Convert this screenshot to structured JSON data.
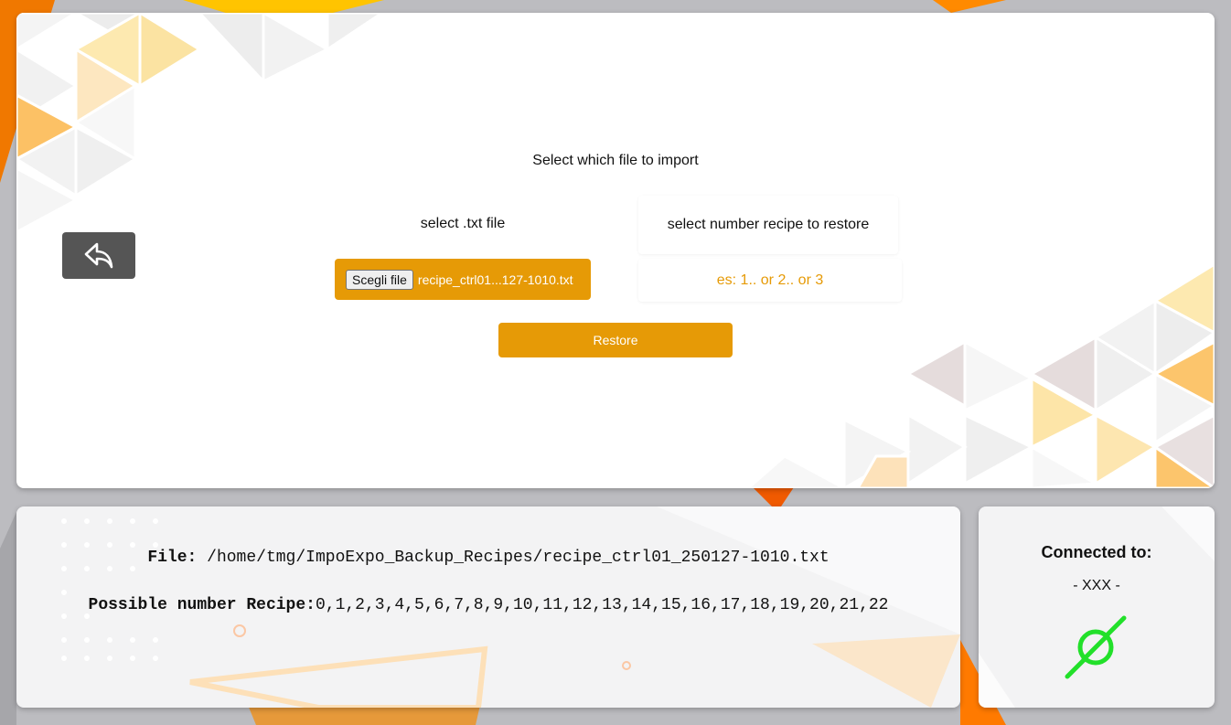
{
  "main": {
    "title": "Select which file to import",
    "file_label": "select .txt file",
    "recipe_label": "select number recipe to restore",
    "choose_button_label": "Scegli file",
    "selected_file": "recipe_ctrl01...127-1010.txt",
    "recipe_placeholder": "es: 1.. or 2.. or 3",
    "restore_label": "Restore",
    "back_icon": "undo-arrow-icon"
  },
  "info": {
    "file_label": "File:",
    "file_path": " /home/tmg/ImpoExpo_Backup_Recipes/recipe_ctrl01_250127-1010.txt",
    "recipes_label": "Possible number Recipe:",
    "recipes_list": "0,1,2,3,4,5,6,7,8,9,10,11,12,13,14,15,16,17,18,19,20,21,22"
  },
  "connection": {
    "title": "Connected to:",
    "name": "- XXX -",
    "status_icon": "plug-connected-icon",
    "status_color": "#22e02a"
  },
  "theme": {
    "accent": "#e69a06",
    "back_button": "#555555"
  }
}
